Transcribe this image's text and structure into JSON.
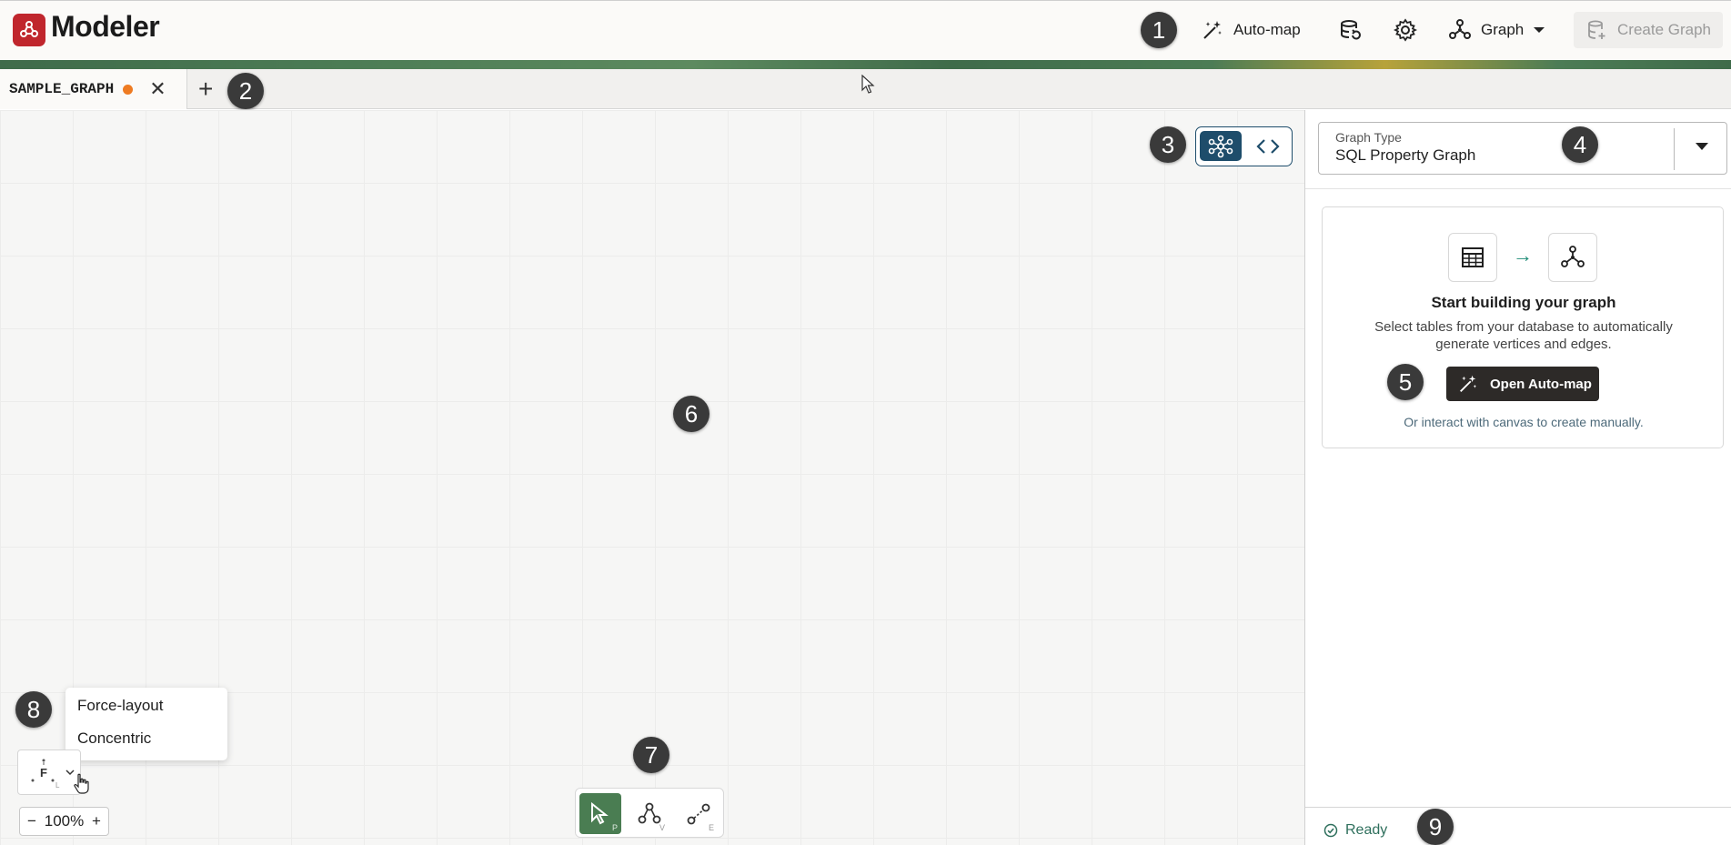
{
  "app": {
    "title": "Modeler"
  },
  "header": {
    "automap_label": "Auto-map",
    "graph_label": "Graph",
    "create_graph_label": "Create Graph"
  },
  "tabs": [
    {
      "label": "SAMPLE_GRAPH",
      "unsaved": true,
      "close": "✕"
    }
  ],
  "add_tab": "+",
  "view_toggle": {
    "graph_view": "graph-view-icon",
    "code_view": "code-icon"
  },
  "graph_type": {
    "label": "Graph Type",
    "value": "SQL Property Graph"
  },
  "empty_state": {
    "title": "Start building your graph",
    "description": "Select tables from your database to automatically generate vertices and edges.",
    "button_label": "Open Auto-map",
    "footer": "Or interact with canvas to create manually.",
    "arrow": "→"
  },
  "layout_menu": {
    "items": [
      "Force-layout",
      "Concentric"
    ]
  },
  "layout_button": {
    "letter": "F",
    "sub": "L"
  },
  "zoom": {
    "minus": "−",
    "level": "100%",
    "plus": "+"
  },
  "toolbar": {
    "tools": [
      {
        "name": "pointer",
        "shortcut": "P"
      },
      {
        "name": "vertex",
        "shortcut": "V"
      },
      {
        "name": "edge",
        "shortcut": "E"
      }
    ]
  },
  "status": {
    "text": "Ready"
  },
  "badges": [
    "1",
    "2",
    "3",
    "4",
    "5",
    "6",
    "7",
    "8",
    "9"
  ],
  "colors": {
    "brand_red": "#c0262d",
    "accent_blue": "#1e4d6b",
    "active_tool_green": "#4a7d52",
    "unsaved_dot": "#ee7b22",
    "status_green": "#2e6f5c"
  }
}
